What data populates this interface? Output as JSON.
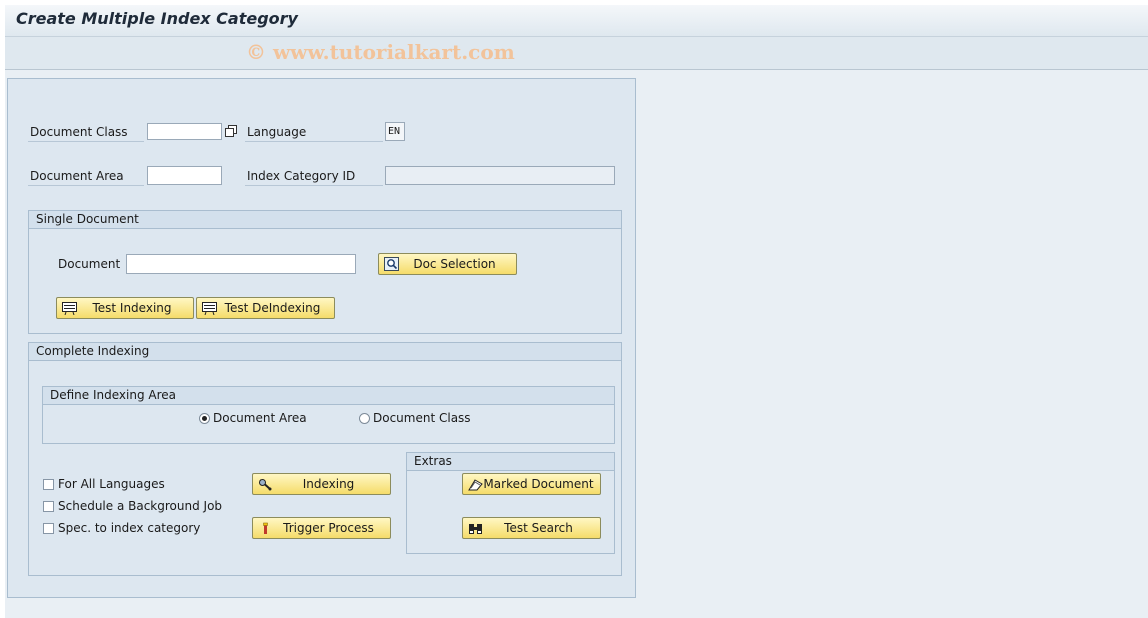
{
  "window": {
    "title": "Create Multiple Index Category",
    "watermark": "© www.tutorialkart.com"
  },
  "header_fields": {
    "document_class_label": "Document Class",
    "document_class_value": "",
    "language_label": "Language",
    "language_value": "EN",
    "document_area_label": "Document Area",
    "document_area_value": "",
    "index_category_id_label": "Index Category ID",
    "index_category_id_value": ""
  },
  "single_document": {
    "title": "Single Document",
    "document_label": "Document",
    "document_value": "",
    "doc_selection_label": "Doc Selection",
    "test_indexing_label": "Test Indexing",
    "test_deindexing_label": "Test DeIndexing"
  },
  "complete_indexing": {
    "title": "Complete Indexing",
    "define_area": {
      "title": "Define Indexing Area",
      "options": [
        {
          "label": "Document Area",
          "selected": true
        },
        {
          "label": "Document Class",
          "selected": false
        }
      ]
    },
    "checkboxes": [
      {
        "label": "For All Languages",
        "checked": false
      },
      {
        "label": "Schedule a Background Job",
        "checked": false
      },
      {
        "label": "Spec. to index category",
        "checked": false
      }
    ],
    "indexing_label": "Indexing",
    "trigger_process_label": "Trigger Process",
    "extras": {
      "title": "Extras",
      "marked_document_label": "Marked Document",
      "test_search_label": "Test Search"
    }
  },
  "icons": [
    "matchcode-icon",
    "doc-search-icon",
    "test-indexing-icon",
    "test-deindexing-icon",
    "indexing-icon",
    "trigger-process-icon",
    "marked-document-icon",
    "binoculars-icon"
  ],
  "colors": {
    "button_face": "#f5dc6a",
    "panel_bg": "#dde7f0",
    "group_header": "#d3e0ec"
  }
}
